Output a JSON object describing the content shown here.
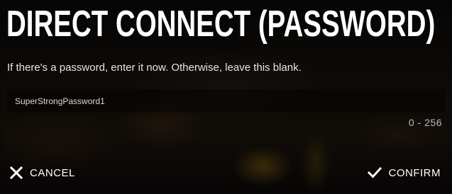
{
  "dialog": {
    "title": "DIRECT CONNECT (PASSWORD)",
    "instructions": "If there's a password, enter it now. Otherwise, leave this blank.",
    "password_field": {
      "value": "SuperStrongPassword1",
      "length_range": "0 - 256"
    },
    "actions": {
      "cancel": {
        "label": "CANCEL",
        "icon": "close-icon"
      },
      "confirm": {
        "label": "CONFIRM",
        "icon": "checkmark-icon"
      }
    }
  },
  "colors": {
    "text_primary": "#ffffff",
    "text_secondary": "#bdbdbd",
    "field_background": "rgba(0,0,0,0.35)"
  }
}
